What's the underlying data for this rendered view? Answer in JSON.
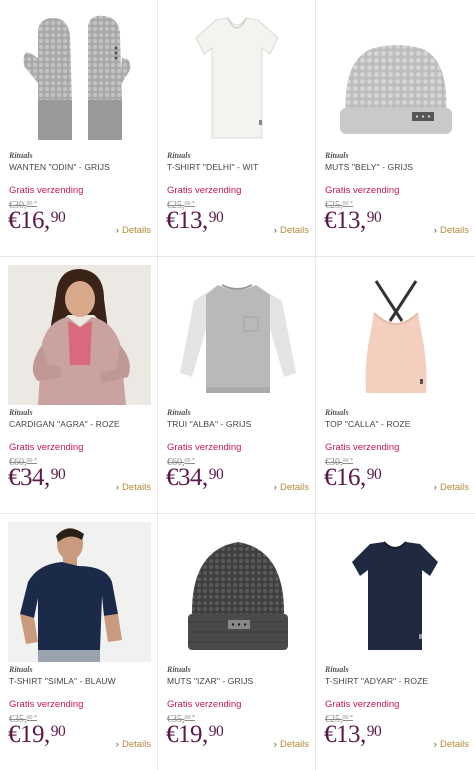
{
  "products": [
    {
      "brand": "Rituals",
      "name": "WANTEN \"ODIN\" - GRIJS",
      "shipping": "Gratis verzending",
      "old_price": "€30,",
      "old_cents": "00 *",
      "price": "€16,",
      "cents": "90",
      "details": "Details",
      "image": "gray knitted mittens"
    },
    {
      "brand": "Rituals",
      "name": "T-SHIRT \"DELHI\" - WIT",
      "shipping": "Gratis verzending",
      "old_price": "€25,",
      "old_cents": "00 *",
      "price": "€13,",
      "cents": "90",
      "details": "Details",
      "image": "white v-neck t-shirt"
    },
    {
      "brand": "Rituals",
      "name": "MUTS \"BELY\" - GRIJS",
      "shipping": "Gratis verzending",
      "old_price": "€25,",
      "old_cents": "00 *",
      "price": "€13,",
      "cents": "90",
      "details": "Details",
      "image": "light gray knitted beanie"
    },
    {
      "brand": "Rituals",
      "name": "CARDIGAN \"AGRA\" - ROZE",
      "shipping": "Gratis verzending",
      "old_price": "€60,",
      "old_cents": "00 *",
      "price": "€34,",
      "cents": "90",
      "details": "Details",
      "image": "woman in pink cardigan"
    },
    {
      "brand": "Rituals",
      "name": "TRUI \"ALBA\" - GRIJS",
      "shipping": "Gratis verzending",
      "old_price": "€60,",
      "old_cents": "00 *",
      "price": "€34,",
      "cents": "90",
      "details": "Details",
      "image": "gray raglan sweater"
    },
    {
      "brand": "Rituals",
      "name": "TOP \"CALLA\" - ROZE",
      "shipping": "Gratis verzending",
      "old_price": "€30,",
      "old_cents": "00 *",
      "price": "€16,",
      "cents": "90",
      "details": "Details",
      "image": "pink strappy top"
    },
    {
      "brand": "Rituals",
      "name": "T-SHIRT \"SIMLA\" - BLAUW",
      "shipping": "Gratis verzending",
      "old_price": "€35,",
      "old_cents": "00 *",
      "price": "€19,",
      "cents": "90",
      "details": "Details",
      "image": "man in navy t-shirt"
    },
    {
      "brand": "Rituals",
      "name": "MUTS \"IZAR\" - GRIJS",
      "shipping": "Gratis verzending",
      "old_price": "€35,",
      "old_cents": "00 *",
      "price": "€19,",
      "cents": "90",
      "details": "Details",
      "image": "dark gray knitted beanie"
    },
    {
      "brand": "Rituals",
      "name": "T-SHIRT \"ADYAR\" - ROZE",
      "shipping": "Gratis verzending",
      "old_price": "€25,",
      "old_cents": "00 *",
      "price": "€13,",
      "cents": "90",
      "details": "Details",
      "image": "navy t-shirt"
    }
  ],
  "colors": {
    "shipping": "#c2185b",
    "price": "#5a1a4a",
    "details": "#b08a3a"
  }
}
